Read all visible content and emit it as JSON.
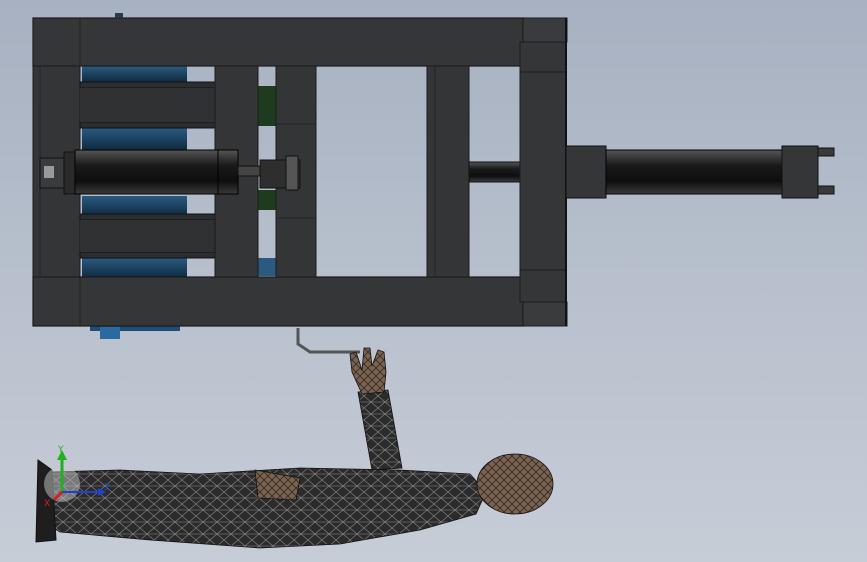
{
  "viewport": {
    "background_top": "#a7b1c1",
    "background_bottom": "#c7cdd7"
  },
  "triad": {
    "x_label": "X",
    "y_label": "Y",
    "z_label": "Z",
    "x_color": "#d22020",
    "y_color": "#22b022",
    "z_color": "#2040d0"
  },
  "colors": {
    "frame": "#353637",
    "frame_edge": "#1c1c1c",
    "inner_blue": "#16364f",
    "inner_green": "#1f3b1f",
    "mannequin": "#2b2b2b",
    "mannequin_skin": "#6a5545",
    "mesh_line": "#8a8a8a"
  },
  "icons": [
    "coordinate-triad-icon"
  ]
}
